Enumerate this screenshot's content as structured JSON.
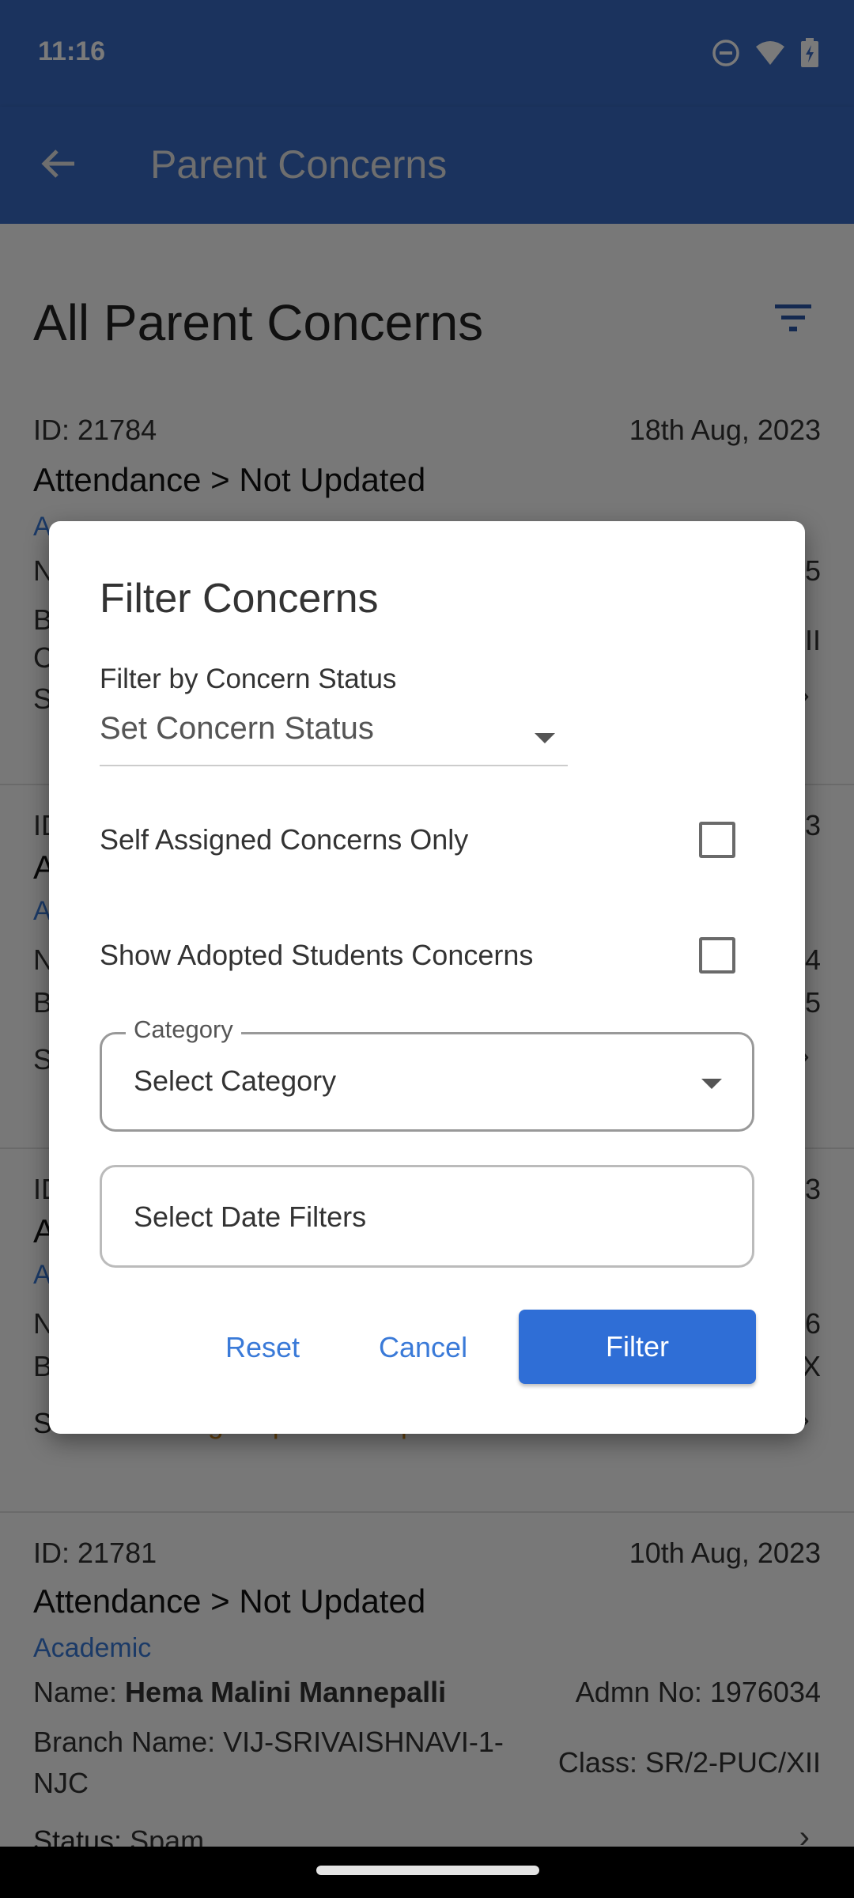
{
  "status_bar": {
    "time": "11:16",
    "icons": [
      "do-not-disturb-icon",
      "wifi-icon",
      "battery-charging-icon"
    ]
  },
  "app_bar": {
    "back_icon": "arrow-left-icon",
    "title": "Parent Concerns"
  },
  "page": {
    "title": "All Parent Concerns",
    "filter_icon": "filter-list-icon"
  },
  "concerns": [
    {
      "id": "ID: 21784",
      "date": "18th Aug, 2023",
      "subject": "Attendance > Not Updated",
      "category": "A",
      "name_prefix": "N",
      "line2_prefix": "B",
      "line3_prefix": "C",
      "status_prefix": "S",
      "right1": "5",
      "right2": "II"
    },
    {
      "id_prefix": "ID",
      "date_suffix": "3",
      "subject_prefix": "A",
      "category_prefix": "A",
      "name_prefix": "N",
      "branch_prefix": "B",
      "status_prefix": "S",
      "right1": "4",
      "right2": "5"
    },
    {
      "id_prefix": "ID",
      "date_suffix": "3",
      "subject_prefix": "A",
      "category_prefix": "A",
      "name_prefix": "N",
      "branch_prefix": "B",
      "right1": "6",
      "right2": "X",
      "status_label": "Status:",
      "status_value": "Waiting for parent response"
    },
    {
      "id": "ID: 21781",
      "date": "10th Aug, 2023",
      "subject": "Attendance > Not Updated",
      "category": "Academic",
      "name_label": "Name:",
      "name_value": "Hema Malini Mannepalli",
      "admn": "Admn No: 1976034",
      "branch": "Branch Name: VIJ-SRIVAISHNAVI-1-NJC",
      "class": "Class: SR/2-PUC/XII",
      "status_label": "Status:",
      "status_value": "Spam"
    }
  ],
  "filter_dialog": {
    "title": "Filter Concerns",
    "status_label": "Filter by Concern Status",
    "status_placeholder": "Set Concern Status",
    "self_assigned_label": "Self Assigned Concerns Only",
    "self_assigned_checked": false,
    "adopted_label": "Show Adopted Students Concerns",
    "adopted_checked": false,
    "category_label": "Category",
    "category_placeholder": "Select Category",
    "date_placeholder": "Select Date Filters",
    "reset_label": "Reset",
    "cancel_label": "Cancel",
    "filter_label": "Filter"
  },
  "colors": {
    "primary": "#3a6cc4",
    "accent_button": "#2f6ed6",
    "link": "#3a7ad8",
    "status_waiting": "#d48a1c"
  }
}
